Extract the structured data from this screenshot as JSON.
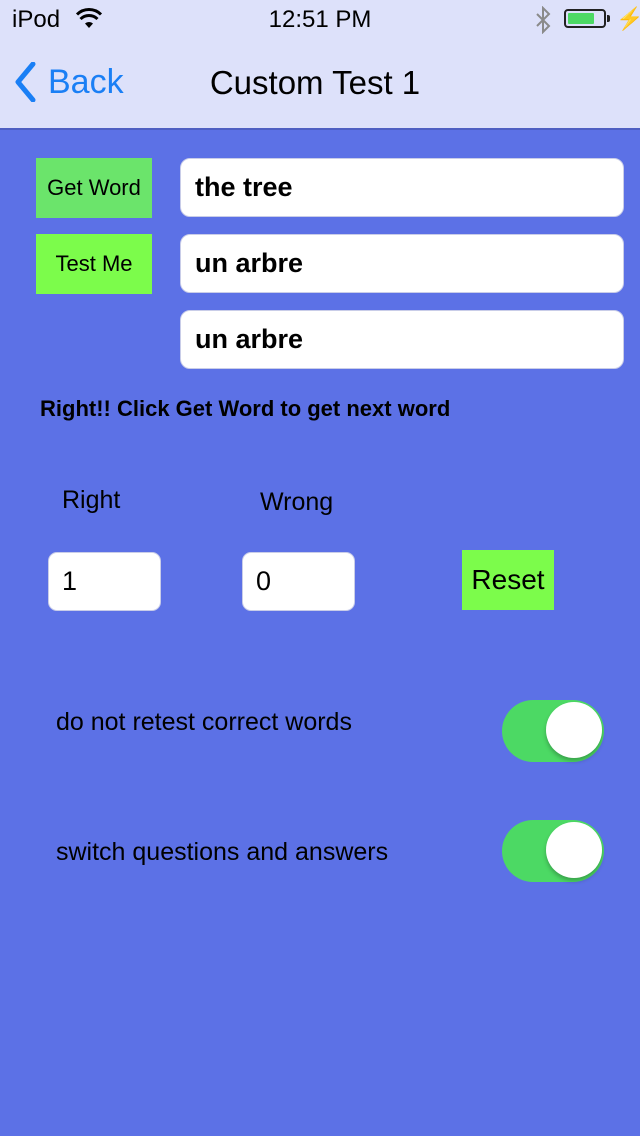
{
  "status_bar": {
    "carrier": "iPod",
    "wifi_icon": "wifi-icon",
    "time": "12:51 PM",
    "bluetooth_icon": "bluetooth-icon",
    "battery_level": 0.75,
    "battery_color": "#4CD964",
    "charging_icon": "⚡"
  },
  "nav": {
    "back_label": "Back",
    "title": "Custom Test 1"
  },
  "buttons": {
    "get_word": "Get Word",
    "test_me": "Test Me",
    "reset": "Reset"
  },
  "fields": {
    "question": "the tree",
    "answer_input": "un arbre",
    "correct_answer": "un arbre"
  },
  "message": "Right!! Click Get Word to get next word",
  "score": {
    "right_label": "Right",
    "wrong_label": "Wrong",
    "right_value": "1",
    "wrong_value": "0"
  },
  "options": [
    {
      "label": "do not retest correct words",
      "on": true
    },
    {
      "label": "switch questions and answers",
      "on": true
    }
  ],
  "colors": {
    "background": "#5C71E6",
    "nav_background": "#DDE1FA",
    "accent": "#1A7FF5",
    "button_green": "#7CFC4B",
    "toggle_on": "#4CD964"
  }
}
